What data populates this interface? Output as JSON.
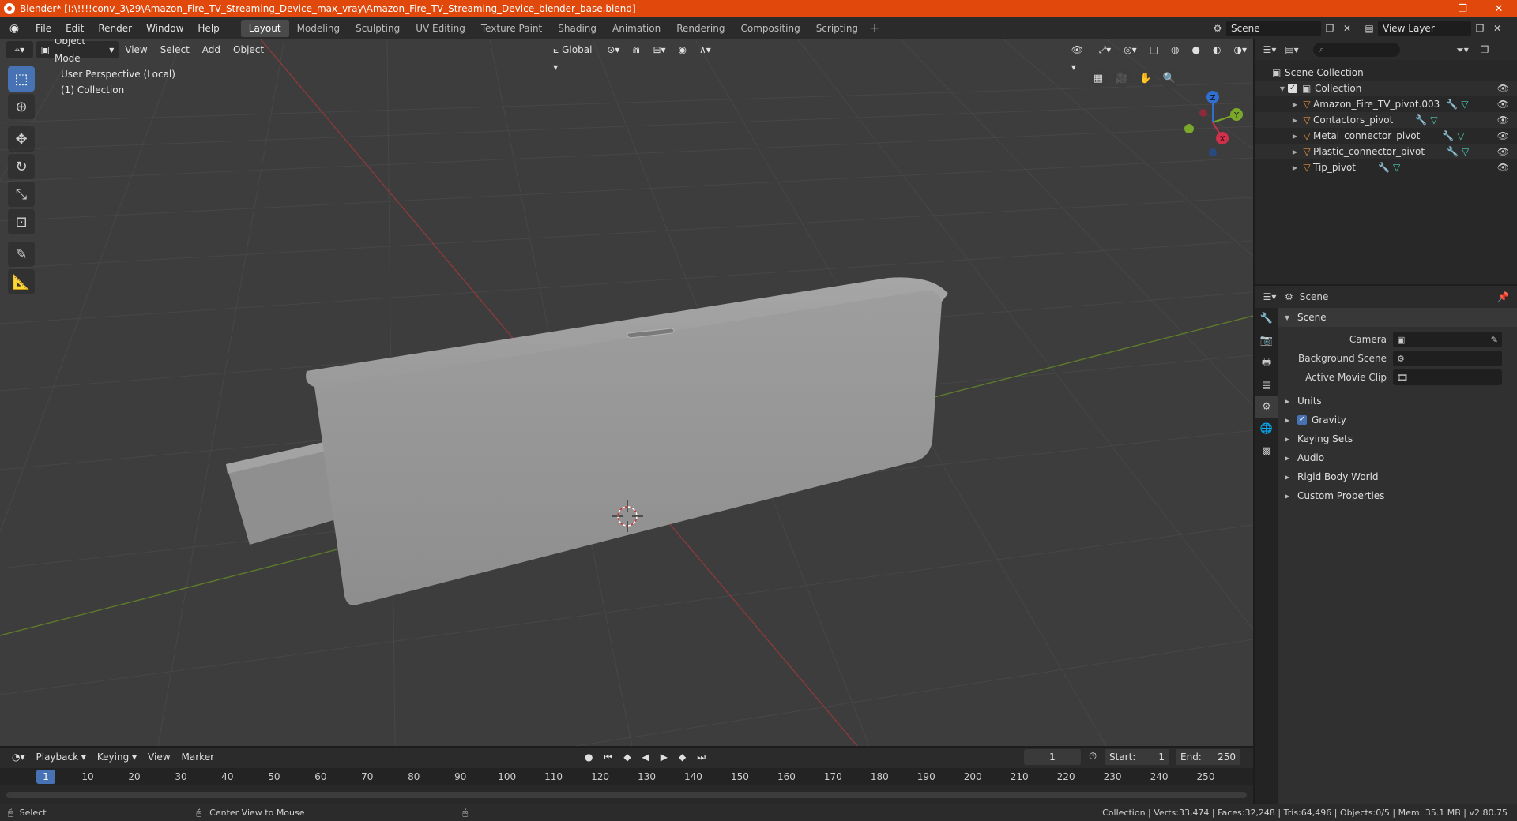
{
  "window": {
    "title": "Blender* [I:\\!!!!conv_3\\29\\Amazon_Fire_TV_Streaming_Device_max_vray\\Amazon_Fire_TV_Streaming_Device_blender_base.blend]",
    "minimize": "—",
    "maximize": "❐",
    "close": "✕"
  },
  "menu": [
    "File",
    "Edit",
    "Render",
    "Window",
    "Help"
  ],
  "workspaces": [
    "Layout",
    "Modeling",
    "Sculpting",
    "UV Editing",
    "Texture Paint",
    "Shading",
    "Animation",
    "Rendering",
    "Compositing",
    "Scripting"
  ],
  "active_workspace": "Layout",
  "scene_field": "Scene",
  "view_layer_field": "View Layer",
  "viewport": {
    "mode": "Object Mode",
    "menus": [
      "View",
      "Select",
      "Add",
      "Object"
    ],
    "orientation": "Global",
    "perspective_label": "User Perspective (Local)",
    "collection_label": "(1) Collection",
    "gizmo": {
      "z": "Z",
      "y": "Y",
      "x": "X"
    }
  },
  "outliner": {
    "root": "Scene Collection",
    "collection": "Collection",
    "objects": [
      "Amazon_Fire_TV_pivot.003",
      "Contactors_pivot",
      "Metal_connector_pivot",
      "Plastic_connector_pivot",
      "Tip_pivot"
    ]
  },
  "properties": {
    "header": "Scene",
    "panel": "Scene",
    "fields": [
      {
        "label": "Camera"
      },
      {
        "label": "Background Scene"
      },
      {
        "label": "Active Movie Clip"
      }
    ],
    "subpanels": [
      "Units",
      "Gravity",
      "Keying Sets",
      "Audio",
      "Rigid Body World",
      "Custom Properties"
    ]
  },
  "timeline": {
    "menus": [
      "Playback",
      "Keying",
      "View",
      "Marker"
    ],
    "current_frame": "1",
    "start_label": "Start:",
    "start": "1",
    "end_label": "End:",
    "end": "250",
    "ruler": [
      "1",
      "10",
      "20",
      "30",
      "40",
      "50",
      "60",
      "70",
      "80",
      "90",
      "100",
      "110",
      "120",
      "130",
      "140",
      "150",
      "160",
      "170",
      "180",
      "190",
      "200",
      "210",
      "220",
      "230",
      "240",
      "250"
    ]
  },
  "status": {
    "left": "Select",
    "middle": "Center View to Mouse",
    "right": "Collection | Verts:33,474 | Faces:32,248 | Tris:64,496 | Objects:0/5 | Mem: 35.1 MB | v2.80.75"
  }
}
